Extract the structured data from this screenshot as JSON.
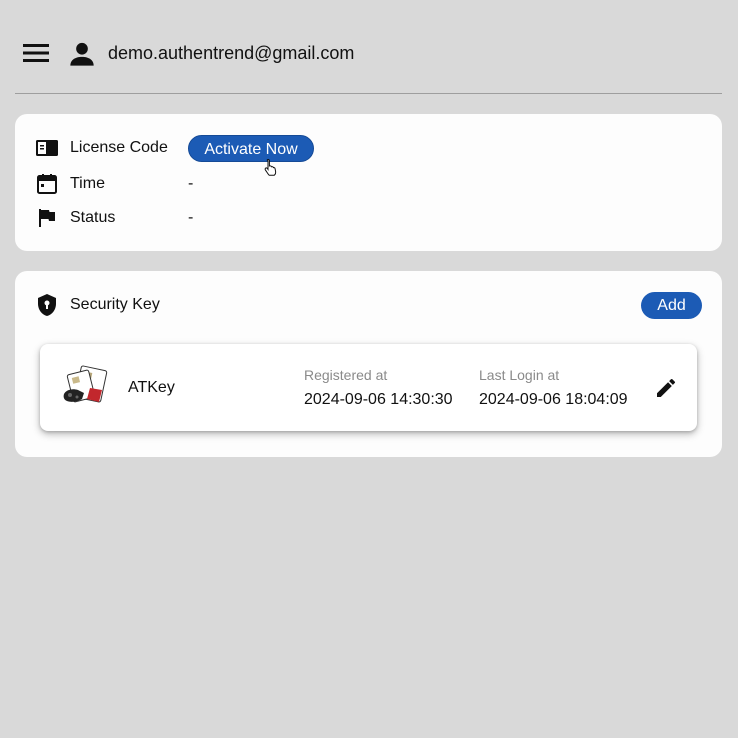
{
  "header": {
    "menu_icon": "hamburger-menu-icon",
    "user_icon": "account-person-icon",
    "email": "demo.authentrend@gmail.com"
  },
  "license": {
    "rows": [
      {
        "icon": "license-card-icon",
        "label": "License Code"
      },
      {
        "icon": "calendar-icon",
        "label": "Time",
        "value": "-"
      },
      {
        "icon": "flag-icon",
        "label": "Status",
        "value": "-"
      }
    ],
    "activate_label": "Activate Now"
  },
  "security": {
    "icon": "shield-icon",
    "title": "Security Key",
    "add_label": "Add",
    "keys": [
      {
        "name": "ATKey",
        "registered_label": "Registered at",
        "registered_value": "2024-09-06 14:30:30",
        "last_login_label": "Last Login at",
        "last_login_value": "2024-09-06 18:04:09",
        "edit_icon": "pencil-edit-icon"
      }
    ]
  },
  "colors": {
    "background": "#d9d9d9",
    "card": "#fdfdfd",
    "accent": "#1c5bb5",
    "muted_text": "#8a8a8a"
  }
}
